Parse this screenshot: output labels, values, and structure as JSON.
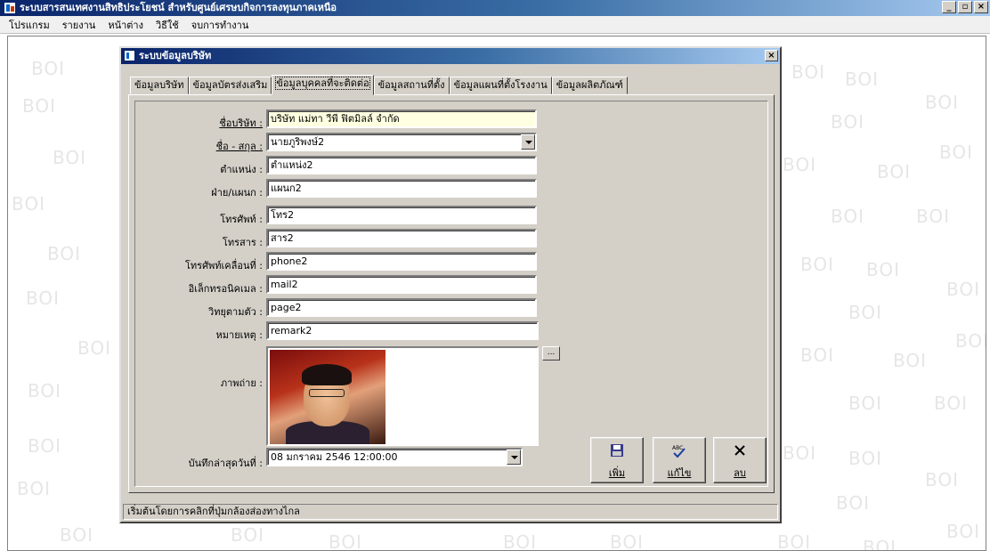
{
  "app": {
    "title": "ระบบสารสนเทศงานสิทธิประโยชน์ สำหรับศูนย์เศรษบกิจการลงทุนภาคเหนือ",
    "controls": [
      "_",
      "▫",
      "×"
    ]
  },
  "menu": {
    "items": [
      "โปรแกรม",
      "รายงาน",
      "หน้าต่าง",
      "วิธีใช้",
      "จบการทำงาน"
    ]
  },
  "watermark": "BOI",
  "child": {
    "title": "ระบบข้อมูลบริษัท",
    "close": "×"
  },
  "tabs": [
    "ข้อมูลบริษัท",
    "ข้อมูลบัตรส่งเสริม",
    "ข้อมูลบุคคลที่จะติดต่อ",
    "ข้อมูลสถานที่ตั้ง",
    "ข้อมูลแผนที่ตั้งโรงงาน",
    "ข้อมูลผลิตภัณฑ์"
  ],
  "form": {
    "company_label": "ชื่อบริษัท :",
    "company_value": "บริษัท แม่ทา วีพี ฟิตมิลล์ จำกัด",
    "name_label": "ชื่อ - สกุล :",
    "name_value": "นายภูริพงษ์2",
    "position_label": "ตำแหน่ง :",
    "position_value": "ตำแหน่ง2",
    "dept_label": "ฝ่าย/แผนก :",
    "dept_value": "แผนก2",
    "phone_label": "โทรศัพท์ :",
    "phone_value": "โทร2",
    "fax_label": "โทรสาร :",
    "fax_value": "สาร2",
    "mobile_label": "โทรศัพท์เคลื่อนที่ :",
    "mobile_value": "phone2",
    "email_label": "อิเล็กทรอนิคเมล :",
    "email_value": "mail2",
    "pager_label": "วิทยุตามตัว :",
    "pager_value": "page2",
    "remark_label": "หมายเหตุ :",
    "remark_value": "remark2",
    "photo_label": "ภาพถ่าย :",
    "browse_label": "...",
    "saved_label": "บันทึกล่าสุดวันที่ :",
    "saved_value": "08  มกราคม   2546  12:00:00"
  },
  "actions": {
    "add_label": "เพิ่ม",
    "edit_label": "แก้ไข",
    "delete_label": "ลบ"
  },
  "status": {
    "text": "เริ่มต้นโดยการคลิกที่ปุ่มกล้องส่องทางไกล"
  }
}
